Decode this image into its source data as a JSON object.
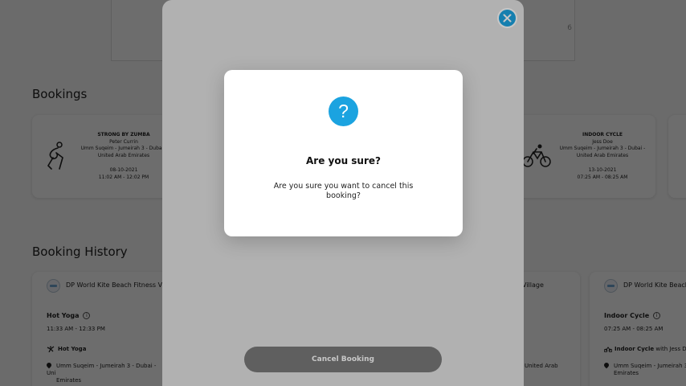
{
  "calendar": {
    "day_number": "6"
  },
  "bookings": {
    "title": "Bookings",
    "cards": [
      {
        "class_name": "STRONG BY ZUMBA",
        "instructor": "Peter Currin",
        "location": "Umm Suqeim - Jumeirah 3 - Dubai - United Arab Emirates",
        "date": "08-10-2021",
        "time": "11:02 AM - 12:02 PM",
        "icon": "zumba-dancer-icon"
      },
      {
        "class_name": "INDOOR CYCLE",
        "instructor": "Jess Doe",
        "location": "Umm Suqeim - Jumeirah 3 - Dubai - United Arab Emirates",
        "date": "13-10-2021",
        "time": "07:25 AM - 08:25 AM",
        "icon": "bicycle-rider-icon"
      }
    ]
  },
  "history": {
    "title": "Booking History",
    "cards": [
      {
        "venue": "DP World Kite Beach Fitness Vil",
        "class_name": "Hot Yoga",
        "time": "11:33 AM - 12:33 PM",
        "class_row": "Hot Yoga",
        "location": "Umm Suqeim - Jumeirah 3 - Dubai - Uni",
        "location_line2": "Emirates"
      },
      {
        "venue_tail": "Village",
        "location_tail": "United Arab"
      },
      {
        "venue": "DP World Kite Beach",
        "class_name": "Indoor Cycle",
        "time": "07:25 AM - 08:25 AM",
        "class_row": "Indoor Cycle",
        "class_row_suffix": "with Jess Doe",
        "location": "Umm Suqeim - Jumeirah 3 - Dubai -",
        "location_line2": "Emirates"
      }
    ]
  },
  "panel": {
    "cancel_booking_label": "Cancel Booking"
  },
  "dialog": {
    "title": "Are you sure?",
    "message": "Are you sure you want to cancel this booking?",
    "icon_glyph": "?"
  },
  "colors": {
    "accent": "#1ba3e0",
    "button_gray": "#7a7a7a",
    "panel_bg": "#e3e3e3"
  }
}
